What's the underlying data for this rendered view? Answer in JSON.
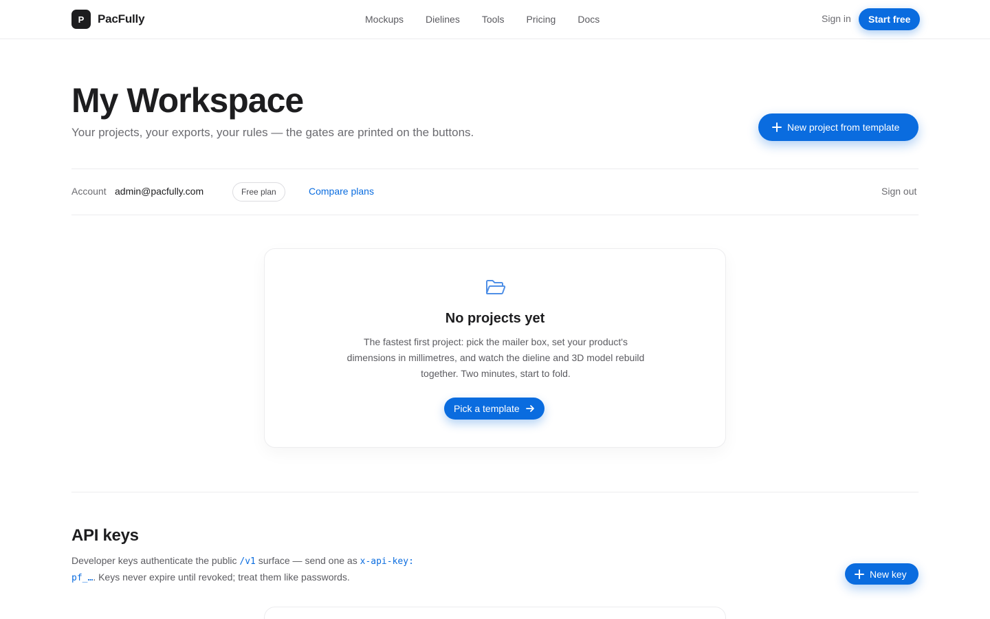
{
  "brand": {
    "mark": "P",
    "name": "PacFully"
  },
  "nav": {
    "links": [
      "Mockups",
      "Dielines",
      "Tools",
      "Pricing",
      "Docs"
    ],
    "sign_in": "Sign in",
    "start_free": "Start free"
  },
  "header": {
    "title": "My Workspace",
    "subtitle": "Your projects, your exports, your rules — the gates are printed on the buttons.",
    "new_project_label": "New project from template"
  },
  "account": {
    "label": "Account",
    "email": "admin@pacfully.com",
    "plan": "Free plan",
    "compare": "Compare plans",
    "sign_out": "Sign out"
  },
  "empty_state": {
    "icon": "folder-open-icon",
    "title": "No projects yet",
    "text": "The fastest first project: pick the mailer box, set your product's dimensions in millimetres, and watch the dieline and 3D model rebuild together. Two minutes, start to fold.",
    "cta": "Pick a template"
  },
  "api_keys": {
    "title": "API keys",
    "desc_1": "Developer keys authenticate the public ",
    "code_1": "/v1",
    "desc_2": " surface — send one as ",
    "code_2": "x-api-key: pf_…",
    "desc_3": ". Keys never expire until revoked; treat them like passwords.",
    "new_key_label": "New key"
  },
  "colors": {
    "accent": "#0a6cdf",
    "text": "#1d1d1f",
    "muted": "#6b6b70",
    "border": "#ececee"
  }
}
